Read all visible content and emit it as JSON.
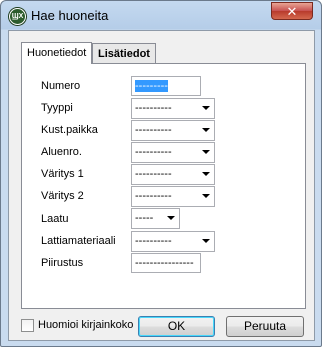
{
  "window": {
    "title": "Hae huoneita",
    "close_label": "✕"
  },
  "tabs": [
    {
      "label": "Huonetiedot",
      "active": true
    },
    {
      "label": "Lisätiedot",
      "active": false
    }
  ],
  "fields": {
    "numero": {
      "label": "Numero",
      "value": "---------"
    },
    "tyyppi": {
      "label": "Tyyppi",
      "value": "----------"
    },
    "kustpaikka": {
      "label": "Kust.paikka",
      "value": "----------"
    },
    "aluenro": {
      "label": "Aluenro.",
      "value": "----------"
    },
    "varitys1": {
      "label": "Väritys 1",
      "value": "----------"
    },
    "varitys2": {
      "label": "Väritys 2",
      "value": "----------"
    },
    "laatu": {
      "label": "Laatu",
      "value": "-----"
    },
    "lattiamateriaali": {
      "label": "Lattiamateriaali",
      "value": "----------"
    },
    "piirustus": {
      "label": "Piirustus",
      "value": "----------------"
    }
  },
  "footer": {
    "case_checkbox_label": "Huomioi kirjainkoko",
    "case_checked": false,
    "ok_label": "OK",
    "cancel_label": "Peruuta"
  }
}
